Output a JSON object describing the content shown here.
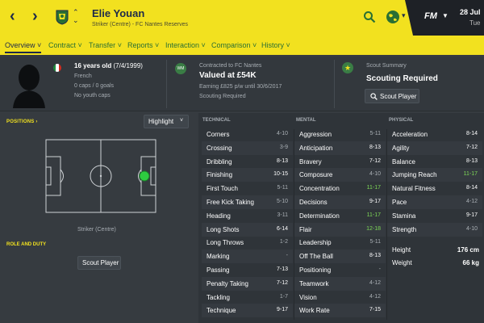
{
  "header": {
    "player_name": "Elie Youan",
    "player_subtitle": "Striker (Centre) - FC Nantes Reserves",
    "brand": "FM",
    "date": "28 Jul",
    "day": "Tue"
  },
  "tabs": [
    {
      "label": "Overview"
    },
    {
      "label": "Contract"
    },
    {
      "label": "Transfer"
    },
    {
      "label": "Reports"
    },
    {
      "label": "Interaction"
    },
    {
      "label": "Comparison"
    },
    {
      "label": "History"
    }
  ],
  "profile": {
    "age": "16 years old",
    "dob": "(7/4/1999)",
    "nationality": "French",
    "caps": "0 caps / 0 goals",
    "youth_caps": "No youth caps"
  },
  "contract": {
    "badge": "WM",
    "header": "Contracted to FC Nantes",
    "value": "Valued at £54K",
    "wage": "Earning £825 p/w until 30/6/2017",
    "status": "Scouting Required"
  },
  "scout": {
    "header": "Scout Summary",
    "status": "Scouting Required",
    "button": "Scout Player"
  },
  "positions": {
    "title": "POSITIONS",
    "highlight": "Highlight",
    "position": "Striker (Centre)",
    "role_title": "ROLE AND DUTY",
    "scout_button": "Scout Player"
  },
  "attributes": {
    "technical_title": "TECHNICAL",
    "mental_title": "MENTAL",
    "physical_title": "PHYSICAL",
    "technical": [
      {
        "name": "Corners",
        "value": "4-10",
        "tone": "dim"
      },
      {
        "name": "Crossing",
        "value": "3-9",
        "tone": "dim"
      },
      {
        "name": "Dribbling",
        "value": "8-13",
        "tone": "white"
      },
      {
        "name": "Finishing",
        "value": "10-15",
        "tone": "white"
      },
      {
        "name": "First Touch",
        "value": "5-11",
        "tone": "dim"
      },
      {
        "name": "Free Kick Taking",
        "value": "5-10",
        "tone": "dim"
      },
      {
        "name": "Heading",
        "value": "3-11",
        "tone": "dim"
      },
      {
        "name": "Long Shots",
        "value": "6-14",
        "tone": "white"
      },
      {
        "name": "Long Throws",
        "value": "1-2",
        "tone": "dim"
      },
      {
        "name": "Marking",
        "value": "-",
        "tone": "dim"
      },
      {
        "name": "Passing",
        "value": "7-13",
        "tone": "white"
      },
      {
        "name": "Penalty Taking",
        "value": "7-12",
        "tone": "white"
      },
      {
        "name": "Tackling",
        "value": "1-7",
        "tone": "dim"
      },
      {
        "name": "Technique",
        "value": "9-17",
        "tone": "white"
      }
    ],
    "mental": [
      {
        "name": "Aggression",
        "value": "5-11",
        "tone": "dim"
      },
      {
        "name": "Anticipation",
        "value": "8-13",
        "tone": "white"
      },
      {
        "name": "Bravery",
        "value": "7-12",
        "tone": "white"
      },
      {
        "name": "Composure",
        "value": "4-10",
        "tone": "dim"
      },
      {
        "name": "Concentration",
        "value": "11-17",
        "tone": "green"
      },
      {
        "name": "Decisions",
        "value": "9-17",
        "tone": "white"
      },
      {
        "name": "Determination",
        "value": "11-17",
        "tone": "green"
      },
      {
        "name": "Flair",
        "value": "12-18",
        "tone": "green"
      },
      {
        "name": "Leadership",
        "value": "5-11",
        "tone": "dim"
      },
      {
        "name": "Off The Ball",
        "value": "8-13",
        "tone": "white"
      },
      {
        "name": "Positioning",
        "value": "-",
        "tone": "dim"
      },
      {
        "name": "Teamwork",
        "value": "4-12",
        "tone": "dim"
      },
      {
        "name": "Vision",
        "value": "4-12",
        "tone": "dim"
      },
      {
        "name": "Work Rate",
        "value": "7-15",
        "tone": "white"
      }
    ],
    "physical": [
      {
        "name": "Acceleration",
        "value": "8-14",
        "tone": "white"
      },
      {
        "name": "Agility",
        "value": "7-12",
        "tone": "white"
      },
      {
        "name": "Balance",
        "value": "8-13",
        "tone": "white"
      },
      {
        "name": "Jumping Reach",
        "value": "11-17",
        "tone": "green"
      },
      {
        "name": "Natural Fitness",
        "value": "8-14",
        "tone": "white"
      },
      {
        "name": "Pace",
        "value": "4-12",
        "tone": "dim"
      },
      {
        "name": "Stamina",
        "value": "9-17",
        "tone": "white"
      },
      {
        "name": "Strength",
        "value": "4-10",
        "tone": "dim"
      }
    ],
    "height_label": "Height",
    "height": "176 cm",
    "weight_label": "Weight",
    "weight": "66 kg"
  },
  "colors": {
    "header": "#f2e11f",
    "tab_text": "#2a6f33",
    "green_value": "#7ed957",
    "pitch_marker": "#2ecc40"
  }
}
